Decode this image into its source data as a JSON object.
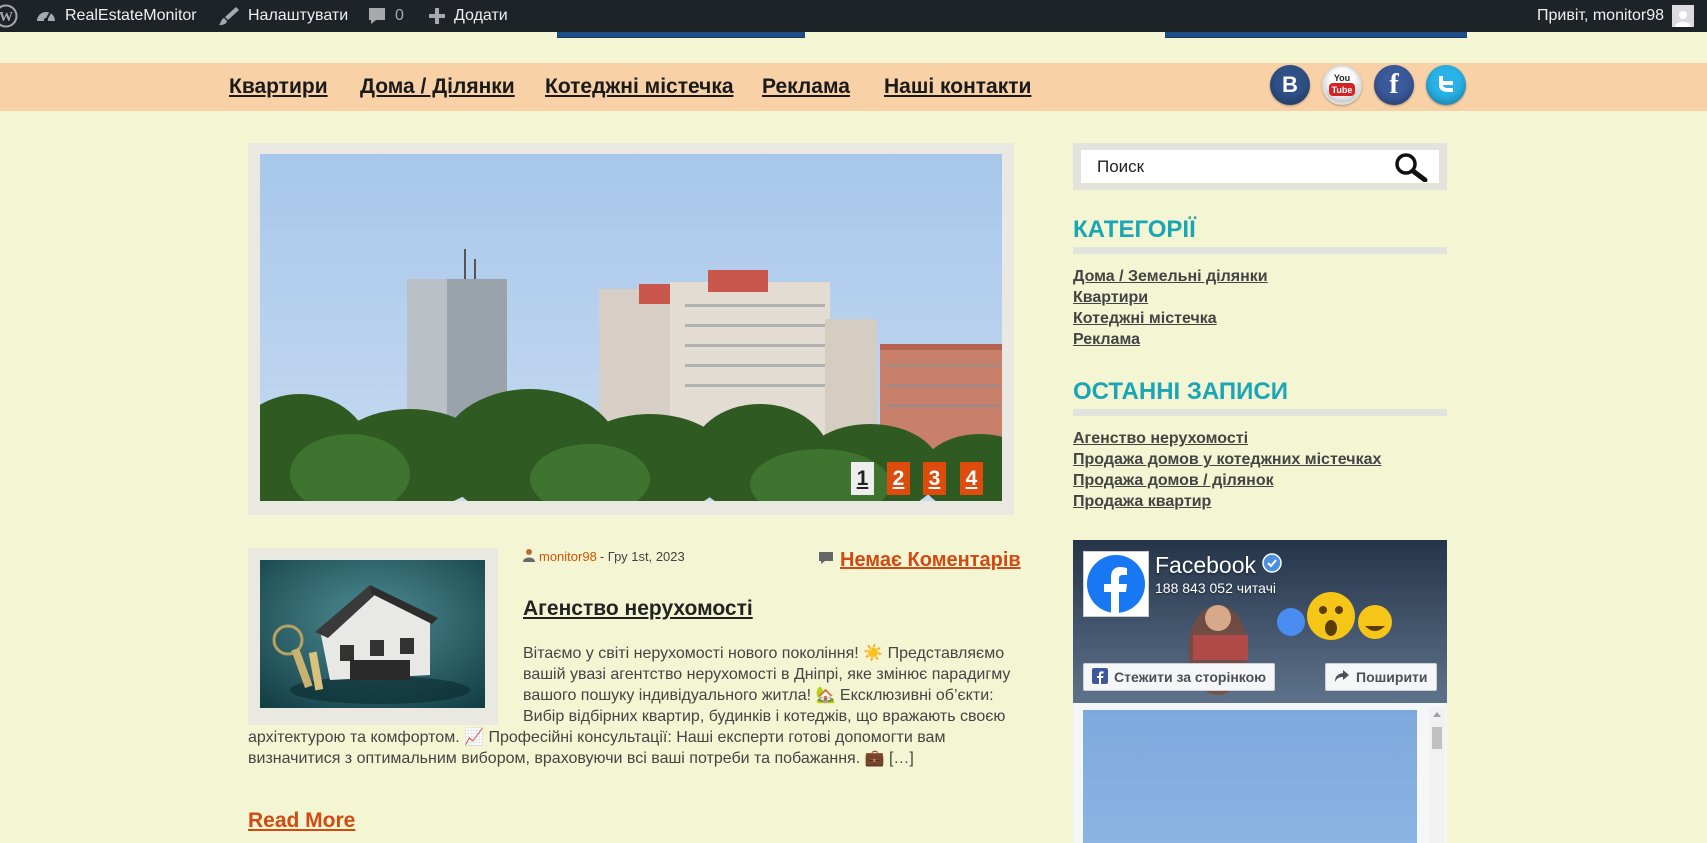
{
  "admin_bar": {
    "site_name": "RealEstateMonitor",
    "customize": "Налаштувати",
    "comments_count": "0",
    "add_new": "Додати",
    "greeting": "Привіт, monitor98"
  },
  "nav": {
    "items": [
      {
        "label": "Квартири"
      },
      {
        "label": "Дома / Ділянки"
      },
      {
        "label": "Котеджні містечка"
      },
      {
        "label": "Реклама"
      },
      {
        "label": "Наші контакти"
      }
    ],
    "social": [
      "vk-icon",
      "youtube-icon",
      "facebook-icon",
      "twitter-icon"
    ]
  },
  "slider": {
    "pages": [
      "1",
      "2",
      "3",
      "4"
    ],
    "active_page": "1"
  },
  "post": {
    "author": "monitor98",
    "date": "- Гру 1st, 2023",
    "comments_link": "Немає Коментарів",
    "title": "Агенство нерухомості",
    "excerpt": "Вітаємо у світі нерухомості нового покоління! ☀️ Представляємо вашій увазі агентство нерухомості в Дніпрі, яке змінює парадигму вашого пошуку індивідуального житла! 🏡 Ексклюзивні об’єкти: Вибір відбірних квартир, будинків і котеджів, що вражають своєю архітектурою та комфортом. 📈 Професійні консультації: Наші експерти готові допомогти вам визначитися з оптимальним вибором, враховуючи всі ваші потреби та побажання. 💼 […]",
    "read_more": "Read More"
  },
  "sidebar": {
    "search_placeholder": "Поиск",
    "categories_title": "КАТЕГОРІЇ",
    "categories": [
      {
        "label": "Дома / Земельні ділянки"
      },
      {
        "label": "Квартири"
      },
      {
        "label": "Котеджні містечка"
      },
      {
        "label": "Реклама"
      }
    ],
    "recent_title": "ОСТАННІ ЗАПИСИ",
    "recent": [
      {
        "label": "Агенство нерухомості"
      },
      {
        "label": "Продажа домов у котеджних містечках"
      },
      {
        "label": "Продажа домов / ділянок"
      },
      {
        "label": "Продажа квартир"
      }
    ]
  },
  "facebook": {
    "name": "Facebook",
    "followers": "188 843 052 читачі",
    "follow_button": "Стежити за сторінкою",
    "share_button": "Поширити"
  },
  "colors": {
    "page_bg": "#f4f5d2",
    "nav_bg": "#f8d1a6",
    "accent_orange": "#d04a12",
    "widget_title": "#1ba6b8",
    "admin_bar": "#1d2327"
  }
}
